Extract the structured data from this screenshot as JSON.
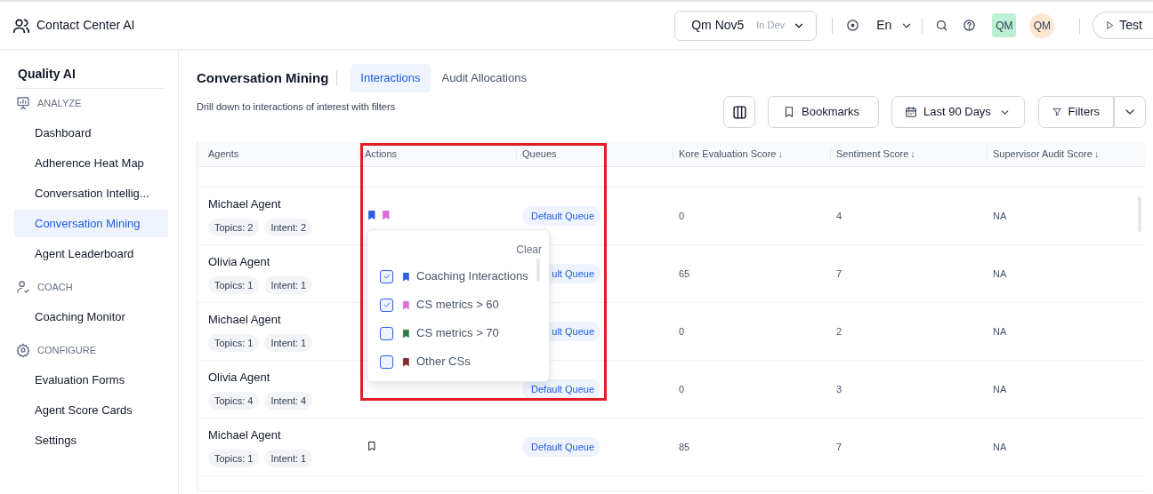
{
  "app": {
    "title": "Contact Center AI"
  },
  "header": {
    "project": "Qm Nov5",
    "environment": "In Dev",
    "language": "En",
    "avatars": [
      {
        "label": "QM",
        "kind": "square"
      },
      {
        "label": "QM",
        "kind": "circle"
      }
    ],
    "test_button": "Test"
  },
  "sidebar": {
    "title": "Quality AI",
    "sections": [
      {
        "label": "ANALYZE",
        "kind": "analyze",
        "items": [
          {
            "label": "Dashboard",
            "selected": false
          },
          {
            "label": "Adherence Heat Map",
            "selected": false
          },
          {
            "label": "Conversation Intellig...",
            "selected": false
          },
          {
            "label": "Conversation Mining",
            "selected": true
          },
          {
            "label": "Agent Leaderboard",
            "selected": false
          }
        ]
      },
      {
        "label": "COACH",
        "kind": "coach",
        "items": [
          {
            "label": "Coaching Monitor",
            "selected": false
          }
        ]
      },
      {
        "label": "CONFIGURE",
        "kind": "configure",
        "items": [
          {
            "label": "Evaluation Forms",
            "selected": false
          },
          {
            "label": "Agent Score Cards",
            "selected": false
          },
          {
            "label": "Settings",
            "selected": false
          }
        ]
      }
    ]
  },
  "page": {
    "title": "Conversation Mining",
    "subtitle": "Drill down to interactions of interest with filters",
    "tabs": [
      {
        "label": "Interactions",
        "selected": true
      },
      {
        "label": "Audit Allocations",
        "selected": false
      }
    ]
  },
  "toolbar": {
    "bookmarks": "Bookmarks",
    "date_range": "Last 90 Days",
    "filters": "Filters"
  },
  "table": {
    "columns": [
      {
        "label": "Agents"
      },
      {
        "label": "Actions"
      },
      {
        "label": "Queues"
      },
      {
        "label": "Kore Evaluation Score",
        "sort": "↓"
      },
      {
        "label": "Sentiment Score",
        "sort": "↓"
      },
      {
        "label": "Supervisor Audit Score",
        "sort": "↓"
      }
    ],
    "rows": [
      {
        "agent": "Michael Agent",
        "topics": "Topics: 2",
        "intent": "Intent: 2",
        "actions": [
          {
            "kind": "filled",
            "color": "#2f5fe0"
          },
          {
            "kind": "filled",
            "color": "#d96fdc"
          }
        ],
        "queue": "Default Queue",
        "kore": "0",
        "sentiment": "4",
        "supervisor": "NA"
      },
      {
        "agent": "Olivia Agent",
        "topics": "Topics: 1",
        "intent": "Intent: 1",
        "queue": "ult Queue",
        "kore": "65",
        "sentiment": "7",
        "supervisor": "NA"
      },
      {
        "agent": "Michael Agent",
        "topics": "Topics: 1",
        "intent": "Intent: 1",
        "queue": "ult Queue",
        "kore": "0",
        "sentiment": "2",
        "supervisor": "NA"
      },
      {
        "agent": "Olivia Agent",
        "topics": "Topics: 4",
        "intent": "Intent: 4",
        "queue": "Default Queue",
        "kore": "0",
        "sentiment": "3",
        "supervisor": "NA"
      },
      {
        "agent": "Michael Agent",
        "topics": "Topics: 1",
        "intent": "Intent: 1",
        "actions": [
          {
            "kind": "outline"
          }
        ],
        "queue": "Default Queue",
        "kore": "85",
        "sentiment": "7",
        "supervisor": "NA"
      }
    ]
  },
  "bookmark_menu": {
    "clear": "Clear",
    "options": [
      {
        "label": "Coaching Interactions",
        "color": "#2f5fe0",
        "checked": true
      },
      {
        "label": "CS metrics > 60",
        "color": "#d96fdc",
        "checked": true
      },
      {
        "label": "CS metrics > 70",
        "color": "#2f7a45",
        "checked": false
      },
      {
        "label": "Other CSs",
        "color": "#7a2b2b",
        "checked": false
      }
    ]
  }
}
